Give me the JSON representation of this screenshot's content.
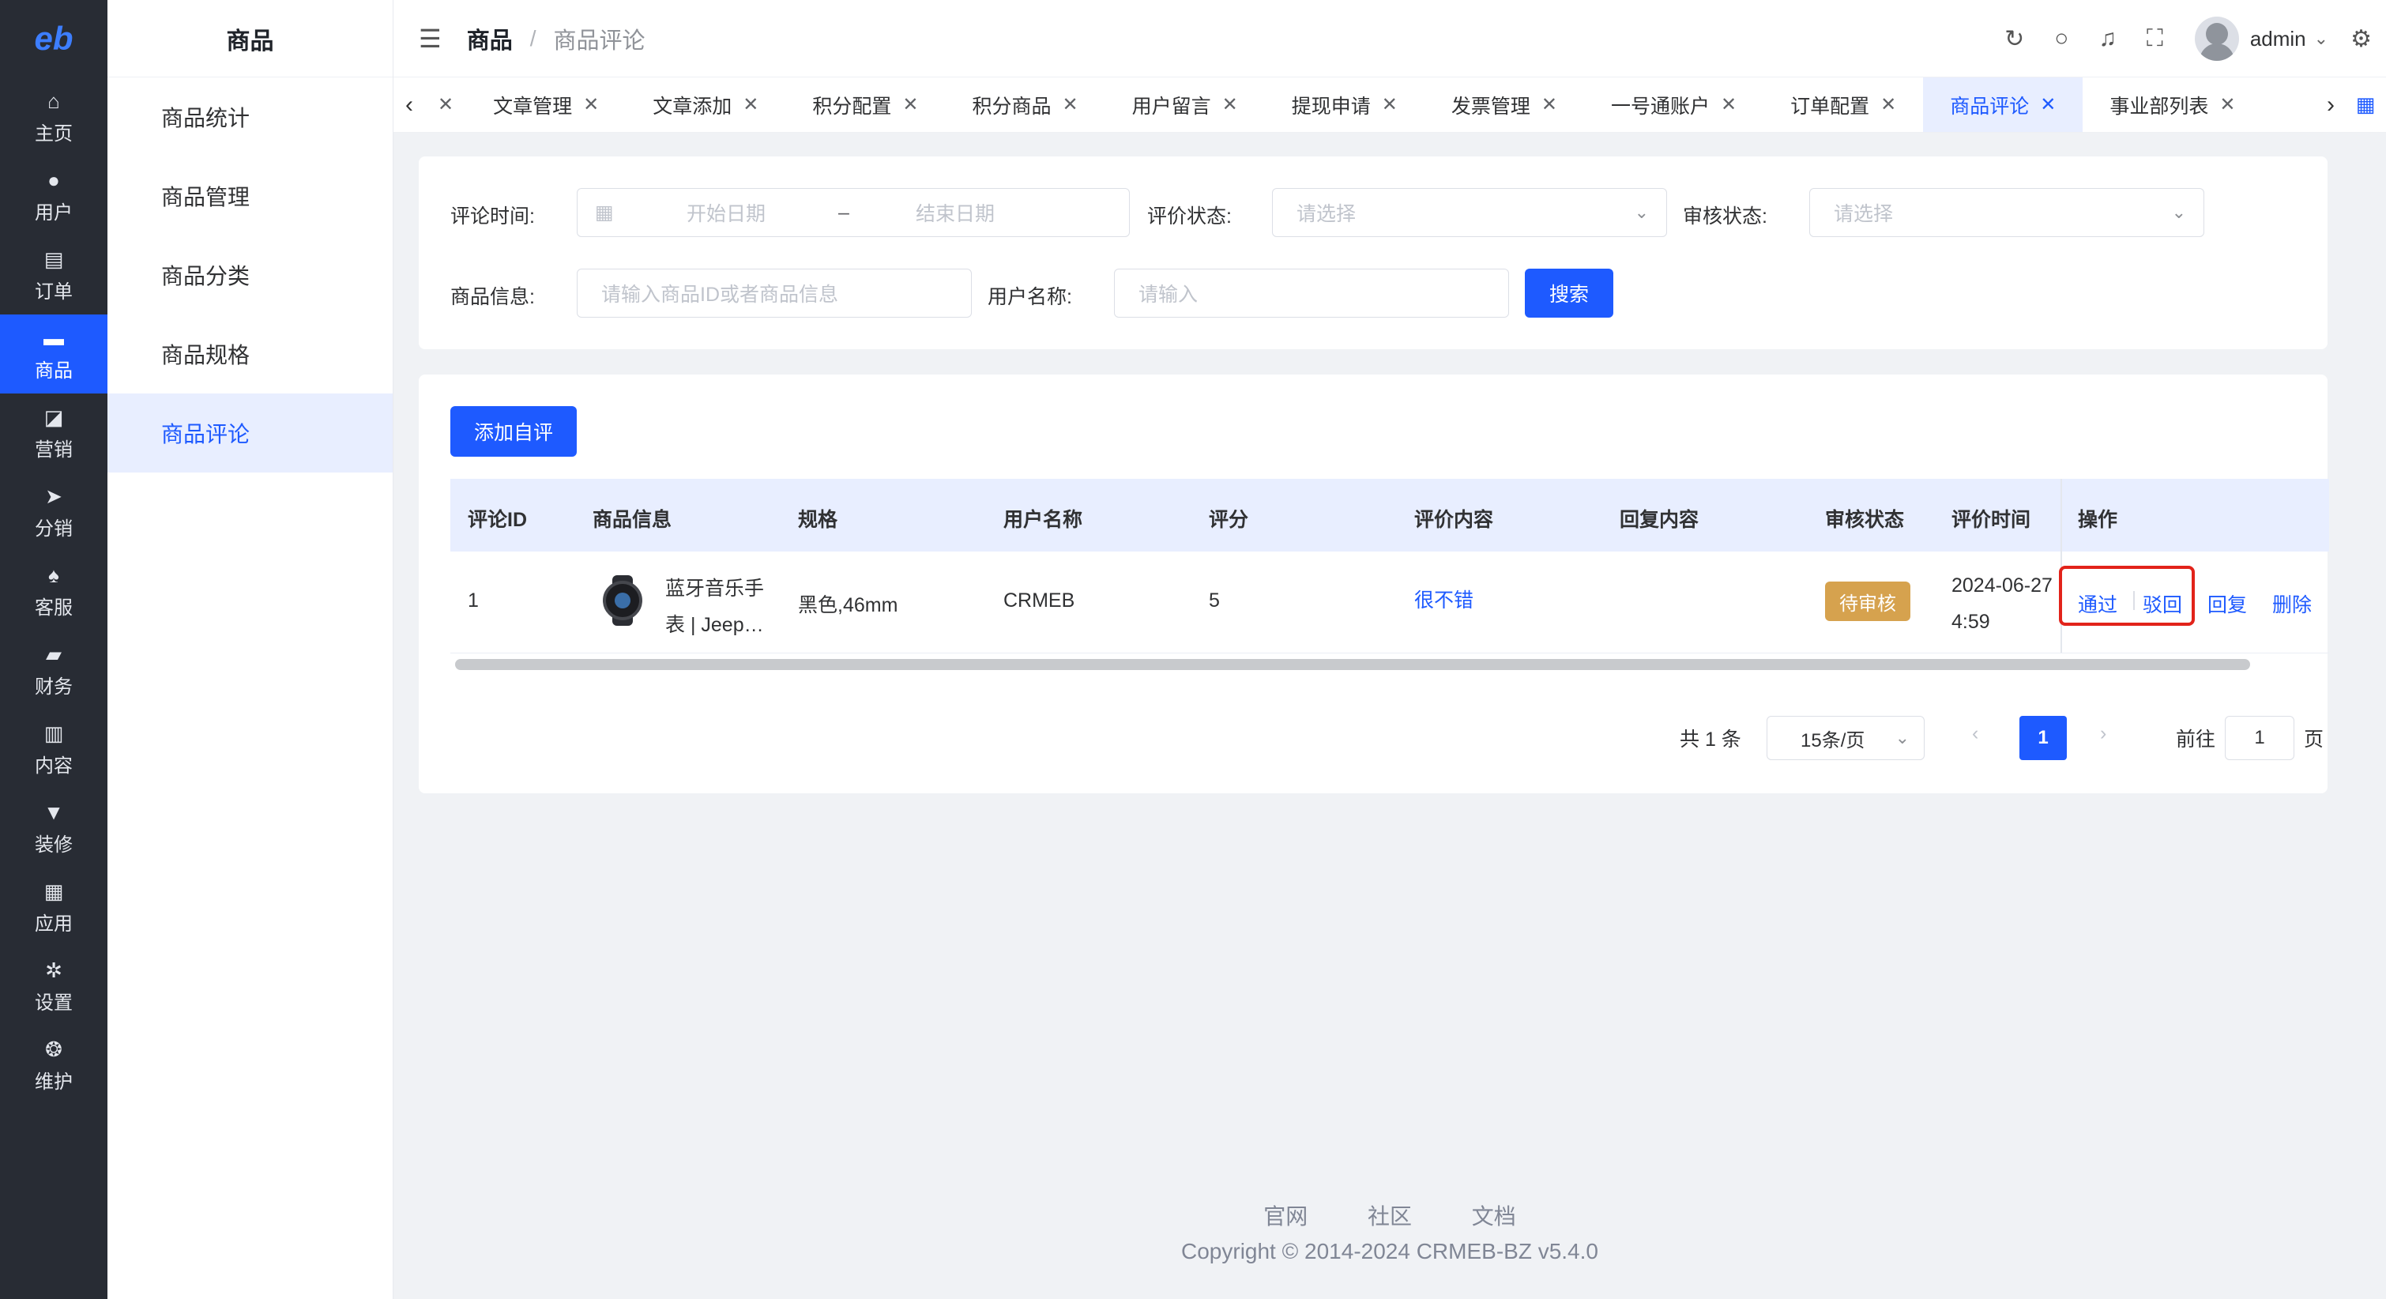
{
  "rail": {
    "logo": "eb",
    "items": [
      {
        "label": "主页",
        "icon": "home-icon",
        "glyph": "⌂"
      },
      {
        "label": "用户",
        "icon": "user-icon",
        "glyph": "●"
      },
      {
        "label": "订单",
        "icon": "order-icon",
        "glyph": "▤"
      },
      {
        "label": "商品",
        "icon": "goods-icon",
        "glyph": "▬"
      },
      {
        "label": "营销",
        "icon": "marketing-icon",
        "glyph": "◪"
      },
      {
        "label": "分销",
        "icon": "distribution-icon",
        "glyph": "➤"
      },
      {
        "label": "客服",
        "icon": "service-icon",
        "glyph": "♠"
      },
      {
        "label": "财务",
        "icon": "finance-icon",
        "glyph": "▰"
      },
      {
        "label": "内容",
        "icon": "content-icon",
        "glyph": "▥"
      },
      {
        "label": "装修",
        "icon": "decoration-icon",
        "glyph": "▼"
      },
      {
        "label": "应用",
        "icon": "apps-icon",
        "glyph": "▦"
      },
      {
        "label": "设置",
        "icon": "settings-icon",
        "glyph": "✲"
      },
      {
        "label": "维护",
        "icon": "maintenance-icon",
        "glyph": "❂"
      }
    ]
  },
  "submenu": {
    "title": "商品",
    "items": [
      "商品统计",
      "商品管理",
      "商品分类",
      "商品规格",
      "商品评论"
    ]
  },
  "header": {
    "breadcrumb_root": "商品",
    "breadcrumb_sep": "/",
    "breadcrumb_current": "商品评论",
    "username": "admin"
  },
  "tabs": [
    "文章管理",
    "文章添加",
    "积分配置",
    "积分商品",
    "用户留言",
    "提现申请",
    "发票管理",
    "一号通账户",
    "订单配置",
    "商品评论",
    "事业部列表"
  ],
  "filters": {
    "comment_time_label": "评论时间:",
    "start_placeholder": "开始日期",
    "range_sep": "–",
    "end_placeholder": "结束日期",
    "rating_status_label": "评价状态:",
    "rating_status_placeholder": "请选择",
    "audit_status_label": "审核状态:",
    "audit_status_placeholder": "请选择",
    "goods_info_label": "商品信息:",
    "goods_info_placeholder": "请输入商品ID或者商品信息",
    "username_label": "用户名称:",
    "username_placeholder": "请输入",
    "search_button": "搜索"
  },
  "list": {
    "add_button": "添加自评",
    "columns": [
      "评论ID",
      "商品信息",
      "规格",
      "用户名称",
      "评分",
      "评价内容",
      "回复内容",
      "审核状态",
      "评价时间",
      "操作"
    ],
    "rows": [
      {
        "id": "1",
        "goods_line1": "蓝牙音乐手",
        "goods_line2": "表 | Jeep…",
        "spec": "黑色,46mm",
        "username": "CRMEB",
        "score": "5",
        "content": "很不错",
        "reply": "",
        "audit_status": "待审核",
        "time_line1": "2024-06-27",
        "time_line2": "4:59",
        "actions": {
          "approve": "通过",
          "reject": "驳回",
          "reply": "回复",
          "delete": "删除"
        }
      }
    ]
  },
  "pagination": {
    "total": "共 1 条",
    "page_size": "15条/页",
    "current": "1",
    "goto_label": "前往",
    "goto_value": "1",
    "page_suffix": "页"
  },
  "footer": {
    "links": [
      "官网",
      "社区",
      "文档"
    ],
    "copyright": "Copyright © 2014-2024 CRMEB-BZ v5.4.0"
  },
  "colors": {
    "primary": "#1e5aff",
    "sidebar_bg": "#282c34",
    "pending_badge": "#d6a24e",
    "highlight_box": "#e2231a"
  }
}
